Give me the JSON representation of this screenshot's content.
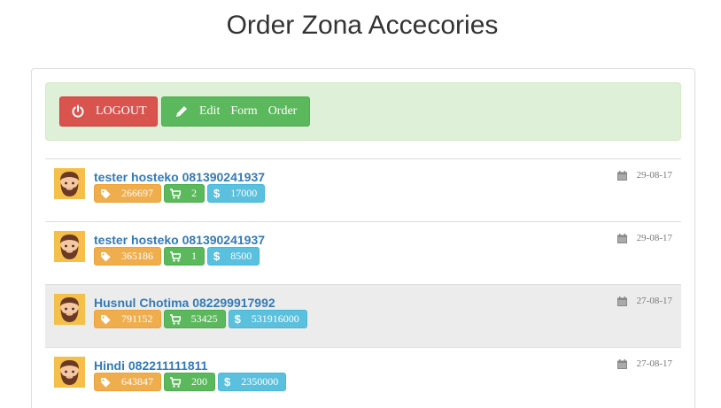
{
  "page": {
    "title": "Order Zona Accecories"
  },
  "toolbar": {
    "logout_label": "LOGOUT",
    "edit_words": [
      "Edit",
      "Form",
      "Order"
    ]
  },
  "icons": {
    "logout": "power-icon",
    "edit": "pencil-icon",
    "date": "calendar-icon",
    "code": "tag-icon",
    "qty": "cart-icon",
    "price": "dollar-icon",
    "avatar": "bearded-man-avatar"
  },
  "colors": {
    "logout": "#d9534f",
    "edit": "#5cb85c",
    "alert_bg": "#dff0d8",
    "code_badge": "#f0ad4e",
    "qty_badge": "#5cb85c",
    "price_badge": "#5bc0de",
    "link": "#337ab7"
  },
  "orders": [
    {
      "customer": "tester hosteko 081390241937",
      "code": "266697",
      "qty": "2",
      "price": "17000",
      "date": "29-08-17",
      "highlighted": false
    },
    {
      "customer": "tester hosteko 081390241937",
      "code": "365186",
      "qty": "1",
      "price": "8500",
      "date": "29-08-17",
      "highlighted": false
    },
    {
      "customer": "Husnul Chotima 082299917992",
      "code": "791152",
      "qty": "53425",
      "price": "531916000",
      "date": "27-08-17",
      "highlighted": true
    },
    {
      "customer": "Hindi 082211111811",
      "code": "643847",
      "qty": "200",
      "price": "2350000",
      "date": "27-08-17",
      "highlighted": false
    }
  ]
}
